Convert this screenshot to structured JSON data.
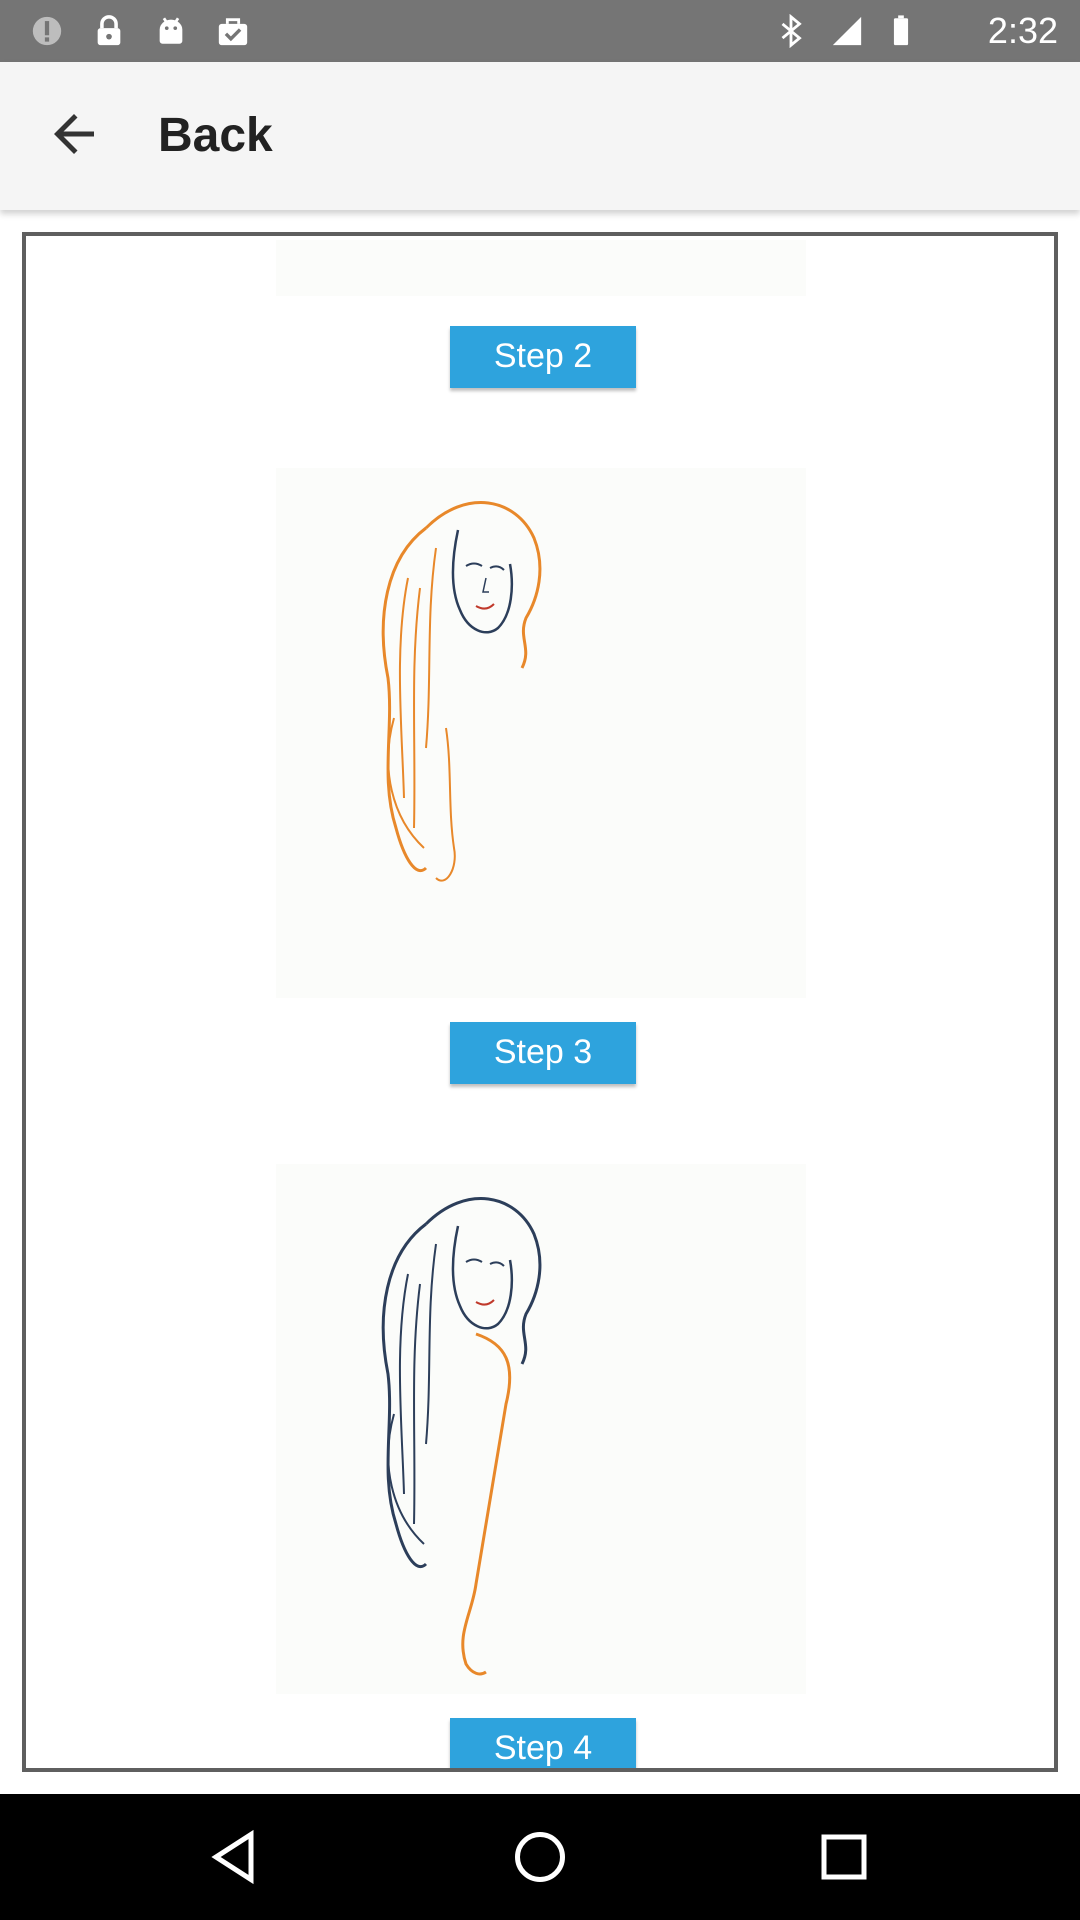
{
  "status_bar": {
    "time": "2:32",
    "left_icons": [
      "info-icon",
      "lock-icon",
      "android-icon",
      "briefcase-check-icon"
    ],
    "right_icons": [
      "bluetooth-icon",
      "signal-icon",
      "battery-icon"
    ]
  },
  "app_bar": {
    "title": "Back",
    "back_icon": "arrow-left-icon"
  },
  "steps": [
    {
      "label": "Step 2"
    },
    {
      "label": "Step 3"
    },
    {
      "label": "Step 4"
    }
  ],
  "images": [
    {
      "name": "step-3-illustration",
      "colors": {
        "hair": "#e8882a",
        "face": "#2c3e5a"
      }
    },
    {
      "name": "step-4-illustration",
      "colors": {
        "hair": "#2c3e5a",
        "body": "#e8882a"
      }
    }
  ],
  "colors": {
    "status_bar": "#757575",
    "app_bar": "#f5f5f5",
    "step_button": "#2ea3dd",
    "frame_border": "#5f5f5f",
    "nav_bar": "#000000"
  },
  "nav_bar": {
    "icons": [
      "back-triangle-icon",
      "home-circle-icon",
      "recents-square-icon"
    ]
  }
}
